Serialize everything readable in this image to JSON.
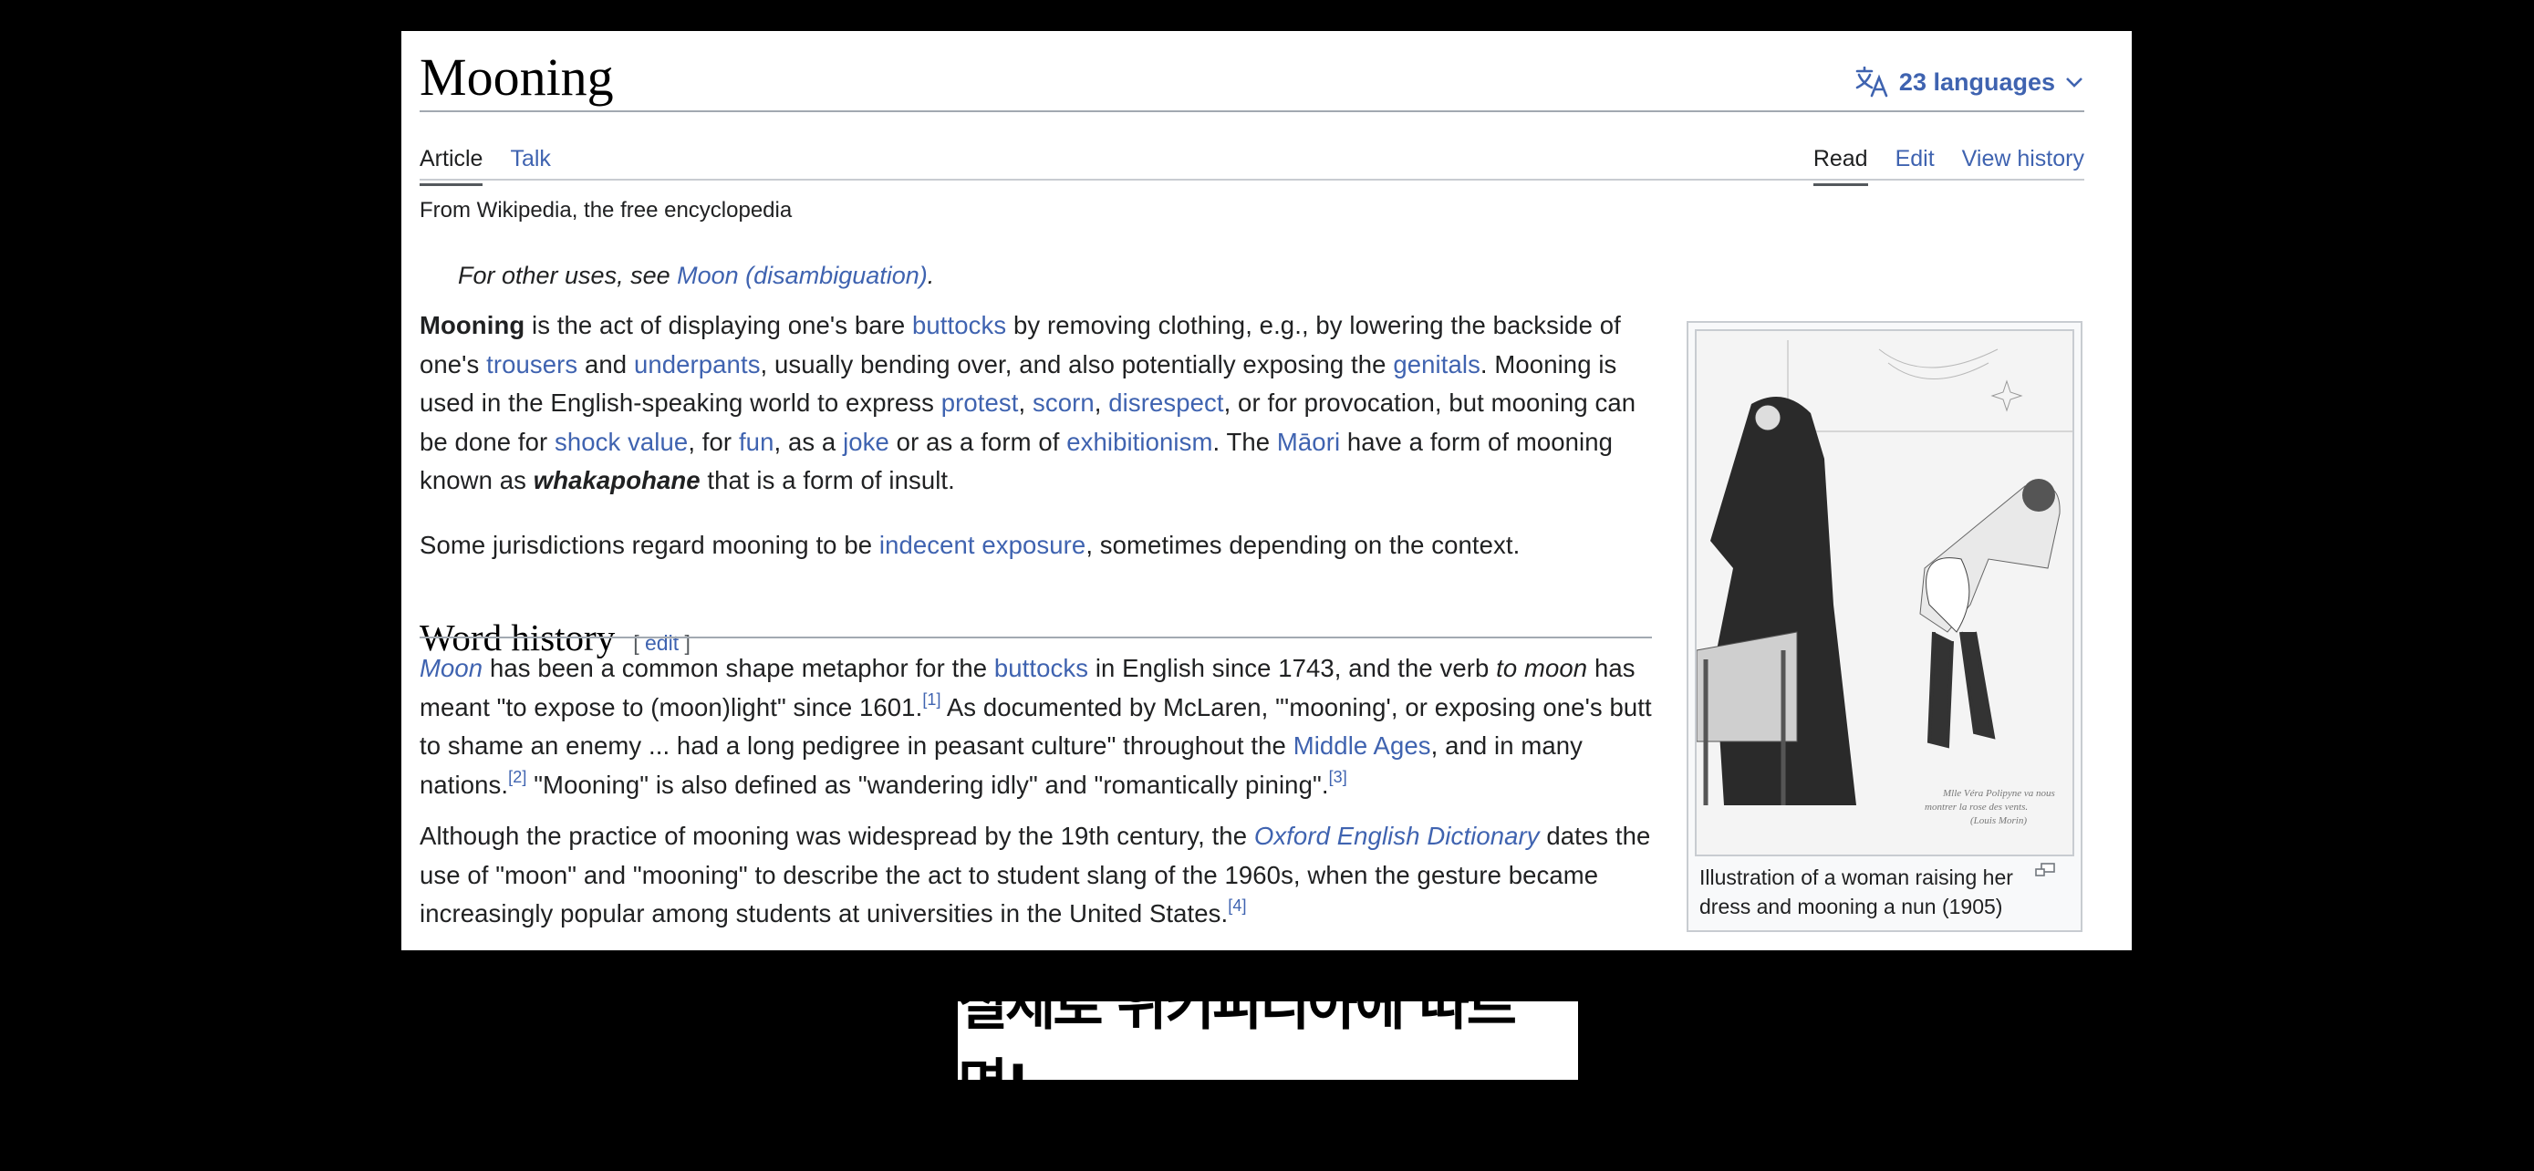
{
  "page": {
    "title": "Mooning",
    "languages_label": "23 languages",
    "left_tabs": [
      {
        "label": "Article",
        "active": true
      },
      {
        "label": "Talk",
        "active": false
      }
    ],
    "right_tabs": [
      {
        "label": "Read",
        "active": true
      },
      {
        "label": "Edit",
        "active": false
      },
      {
        "label": "View history",
        "active": false
      }
    ],
    "tagline": "From Wikipedia, the free encyclopedia",
    "hatnote": {
      "prefix": "For other uses, see ",
      "link": "Moon (disambiguation)",
      "suffix": "."
    },
    "intro": {
      "p1": [
        {
          "t": "Mooning",
          "style": "bold"
        },
        {
          "t": " is the act of displaying one's bare "
        },
        {
          "t": "buttocks",
          "link": true
        },
        {
          "t": " by removing clothing, e.g., by lowering the backside of one's "
        },
        {
          "t": "trousers",
          "link": true
        },
        {
          "t": " and "
        },
        {
          "t": "underpants",
          "link": true
        },
        {
          "t": ", usually bending over, and also potentially exposing the "
        },
        {
          "t": "genitals",
          "link": true
        },
        {
          "t": ". Mooning is used in the English-speaking world to express "
        },
        {
          "t": "protest",
          "link": true
        },
        {
          "t": ", "
        },
        {
          "t": "scorn",
          "link": true
        },
        {
          "t": ", "
        },
        {
          "t": "disrespect",
          "link": true
        },
        {
          "t": ", or for provocation, but mooning can be done for "
        },
        {
          "t": "shock value",
          "link": true
        },
        {
          "t": ", for "
        },
        {
          "t": "fun",
          "link": true
        },
        {
          "t": ", as a "
        },
        {
          "t": "joke",
          "link": true
        },
        {
          "t": " or as a form of "
        },
        {
          "t": "exhibitionism",
          "link": true
        },
        {
          "t": ". The "
        },
        {
          "t": "Māori",
          "link": true
        },
        {
          "t": " have a form of mooning known as "
        },
        {
          "t": "whakapohane",
          "style": "bolditalic"
        },
        {
          "t": " that is a form of insult."
        }
      ],
      "p2": [
        {
          "t": "Some jurisdictions regard mooning to be "
        },
        {
          "t": "indecent exposure",
          "link": true
        },
        {
          "t": ", sometimes depending on the context."
        }
      ]
    },
    "section": {
      "heading": "Word history",
      "edit_open": "[ ",
      "edit_label": "edit",
      "edit_close": " ]",
      "p1": [
        {
          "t": "Moon",
          "link": true,
          "style": "italic"
        },
        {
          "t": " has been a common shape metaphor for the "
        },
        {
          "t": "buttocks",
          "link": true
        },
        {
          "t": " in English since 1743, and the verb "
        },
        {
          "t": "to moon",
          "style": "italic"
        },
        {
          "t": " has meant \"to expose to (moon)light\" since 1601."
        },
        {
          "t": "[1]",
          "ref": true
        },
        {
          "t": " As documented by McLaren, \"'mooning', or exposing one's butt to shame an enemy ... had a long pedigree in peasant culture\" throughout the "
        },
        {
          "t": "Middle Ages",
          "link": true
        },
        {
          "t": ", and in many nations."
        },
        {
          "t": "[2]",
          "ref": true
        },
        {
          "t": " \"Mooning\" is also defined as \"wandering idly\" and \"romantically pining\"."
        },
        {
          "t": "[3]",
          "ref": true
        }
      ],
      "p2": [
        {
          "t": "Although the practice of mooning was widespread by the 19th century, the "
        },
        {
          "t": "Oxford English Dictionary",
          "link": true,
          "style": "italic"
        },
        {
          "t": " dates the use of \"moon\" and \"mooning\" to describe the act to student slang of the 1960s, when the gesture became increasingly popular among students at universities in the United States."
        },
        {
          "t": "[4]",
          "ref": true
        }
      ]
    },
    "figure": {
      "image_alt": "Illustration of a woman raising her dress and mooning a nun (1905)",
      "signature": "Mlle Véra Polipyne va nous montrer la rose des vents. (Louis Morin)",
      "caption": "Illustration of a woman raising her dress and mooning a nun (1905)"
    }
  },
  "subtitle": "실제로 위키피디아에 따르면!",
  "colors": {
    "link": "#3f63b0",
    "text": "#202122",
    "background": "#000000",
    "panel": "#ffffff"
  }
}
